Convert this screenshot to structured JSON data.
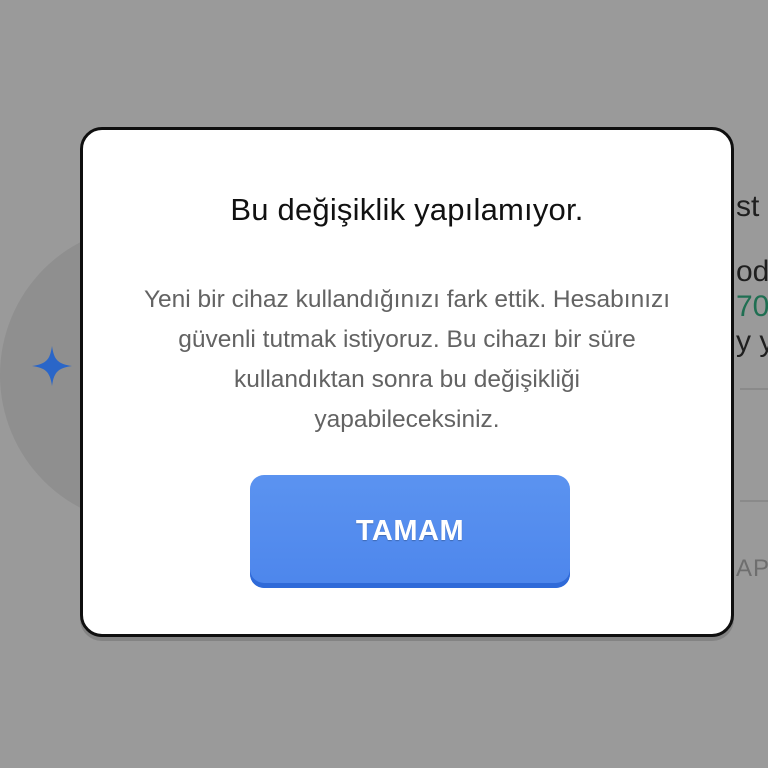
{
  "background": {
    "partial_texts": [
      "st",
      "od",
      "70",
      "y y",
      "AP"
    ]
  },
  "dialog": {
    "title": "Bu değişiklik yapılamıyor.",
    "message": "Yeni bir cihaz kullandığınızı fark ettik. Hesabınızı güvenli tutmak istiyoruz. Bu cihazı bir süre kullandıktan sonra bu değişikliği yapabileceksiniz.",
    "ok_label": "TAMAM"
  },
  "colors": {
    "overlay": "#9a9a9a",
    "button": "#5b93f0",
    "star": "#2a66c8"
  },
  "icons": {
    "background_icon": "sparkle-icon"
  }
}
